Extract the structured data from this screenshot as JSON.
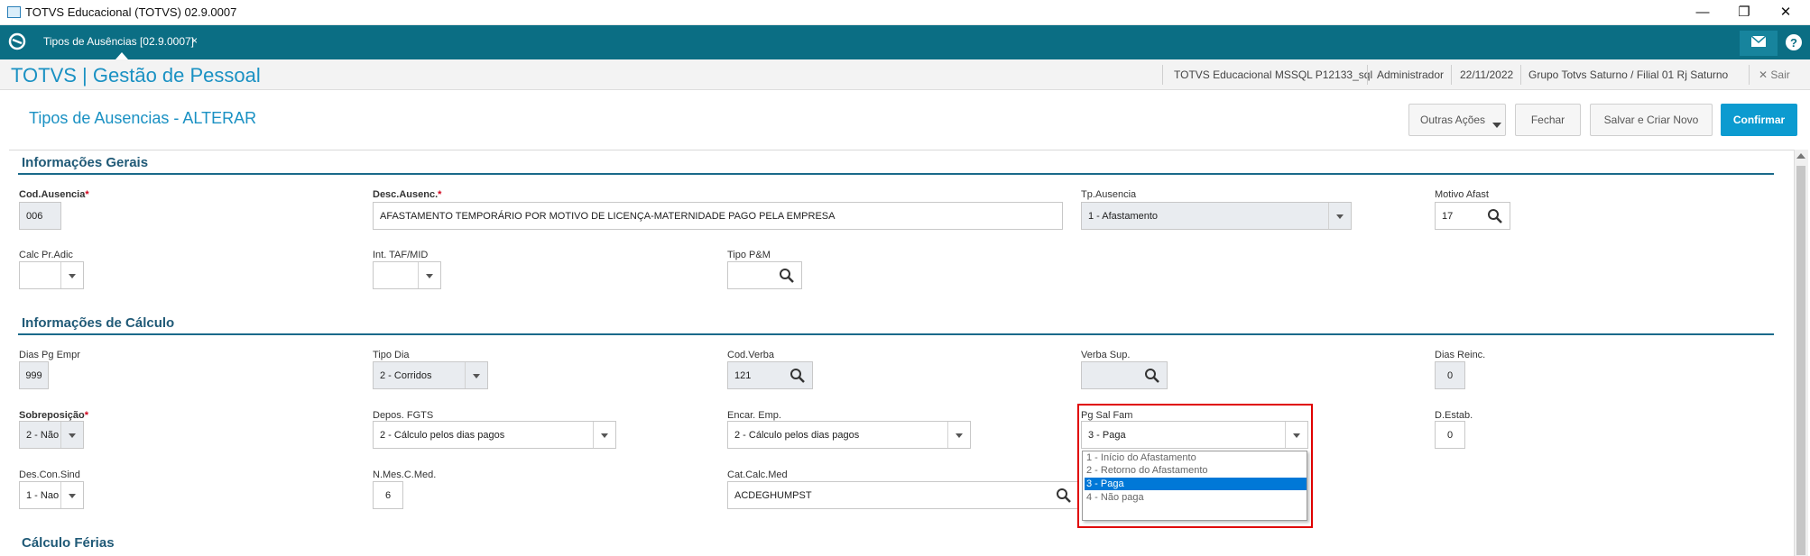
{
  "window": {
    "title": "TOTVS Educacional (TOTVS) 02.9.0007",
    "minimize": "—",
    "restore": "❐",
    "close": "✕"
  },
  "tabbar": {
    "tab_label": "Tipos de Ausências [02.9.0007]",
    "tab_close": "×"
  },
  "header": {
    "brand": "TOTVS | Gestão de Pessoal",
    "environment": "TOTVS Educacional MSSQL P12133_sql",
    "user": "Administrador",
    "date": "22/11/2022",
    "branch": "Grupo Totvs Saturno / Filial 01 Rj Saturno",
    "exit": "Sair"
  },
  "page": {
    "title": "Tipos de Ausencias - ALTERAR"
  },
  "actions": {
    "other": "Outras Ações",
    "close": "Fechar",
    "save_new": "Salvar e Criar Novo",
    "confirm": "Confirmar"
  },
  "sections": {
    "general": "Informações Gerais",
    "calc": "Informações de Cálculo",
    "vacation": "Cálculo Férias"
  },
  "fields": {
    "cod_ausencia": {
      "label": "Cod.Ausencia",
      "value": "006"
    },
    "desc_ausenc": {
      "label": "Desc.Ausenc.",
      "value": "AFASTAMENTO TEMPORÁRIO POR MOTIVO DE LICENÇA-MATERNIDADE PAGO PELA EMPRESA"
    },
    "tp_ausencia": {
      "label": "Tp.Ausencia",
      "value": "1 - Afastamento"
    },
    "motivo_afast": {
      "label": "Motivo Afast",
      "value": "17"
    },
    "calc_pr_adic": {
      "label": "Calc Pr.Adic",
      "value": ""
    },
    "int_taf_mid": {
      "label": "Int. TAF/MID",
      "value": ""
    },
    "tipo_pm": {
      "label": "Tipo P&M",
      "value": ""
    },
    "dias_pg_empr": {
      "label": "Dias Pg Empr",
      "value": "999"
    },
    "tipo_dia": {
      "label": "Tipo Dia",
      "value": "2 - Corridos"
    },
    "cod_verba": {
      "label": "Cod.Verba",
      "value": "121"
    },
    "verba_sup": {
      "label": "Verba Sup.",
      "value": ""
    },
    "dias_reinc": {
      "label": "Dias Reinc.",
      "value": "0"
    },
    "sobreposicao": {
      "label": "Sobreposição",
      "value": "2 - Não"
    },
    "depos_fgts": {
      "label": "Depos. FGTS",
      "value": "2 - Cálculo pelos dias pagos"
    },
    "encar_emp": {
      "label": "Encar. Emp.",
      "value": "2 - Cálculo pelos dias pagos"
    },
    "pg_sal_fam": {
      "label": "Pg Sal Fam",
      "value": "3 - Paga"
    },
    "d_estab": {
      "label": "D.Estab.",
      "value": "0"
    },
    "des_con_sind": {
      "label": "Des.Con.Sind",
      "value": "1 - Nao"
    },
    "n_mes_c_med": {
      "label": "N.Mes.C.Med.",
      "value": "6"
    },
    "cat_calc_med": {
      "label": "Cat.Calc.Med",
      "value": "ACDEGHUMPST"
    }
  },
  "required_mark": "*",
  "pg_sal_fam_options": [
    {
      "label": "1 - Início do Afastamento"
    },
    {
      "label": "2 - Retorno do Afastamento"
    },
    {
      "label": "3 - Paga"
    },
    {
      "label": "4 - Não paga"
    }
  ],
  "selected_option_index": 2,
  "colors": {
    "tabbar": "#0b6e84",
    "brand": "#1a91c3",
    "primary_button": "#0c9bd0",
    "section_line": "#1a6a8a",
    "highlight_box": "#e00000",
    "selected_option": "#0078d7"
  },
  "icons": {
    "home": "refresh-circle-icon",
    "mail": "envelope-icon",
    "help": "question-icon",
    "search": "magnifier-icon",
    "dropdown": "chevron-down-icon"
  }
}
